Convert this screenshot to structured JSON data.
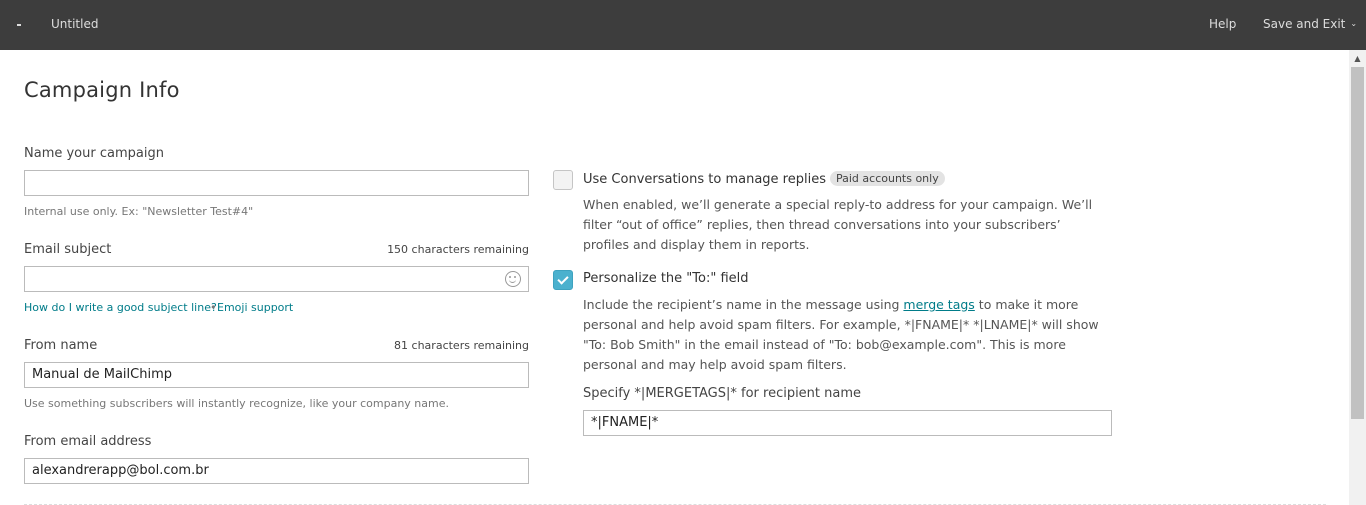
{
  "topbar": {
    "title": "Untitled",
    "help_label": "Help",
    "save_exit_label": "Save and Exit",
    "chevron": "⌄"
  },
  "page": {
    "title": "Campaign Info"
  },
  "campaign_name": {
    "label": "Name your campaign",
    "value": "",
    "help": "Internal use only. Ex: \"Newsletter Test#4\""
  },
  "email_subject": {
    "label": "Email subject",
    "counter": "150 characters remaining",
    "value": "",
    "link_subject": "How do I write a good subject line?",
    "separator": "•",
    "link_emoji": "Emoji support",
    "icon": "emoji-icon"
  },
  "from_name": {
    "label": "From name",
    "counter": "81 characters remaining",
    "value": "Manual de MailChimp",
    "help": "Use something subscribers will instantly recognize, like your company name."
  },
  "from_email": {
    "label": "From email address",
    "value": "alexandrerapp@bol.com.br"
  },
  "conversations": {
    "checked": false,
    "title": "Use Conversations to manage replies",
    "badge": "Paid accounts only",
    "description": "When enabled, we’ll generate a special reply-to address for your campaign. We’ll filter “out of office” replies, then thread conversations into your subscribers’ profiles and display them in reports."
  },
  "personalize": {
    "checked": true,
    "title": "Personalize the \"To:\" field",
    "desc_before": "Include the recipient’s name in the message using ",
    "desc_link": "merge tags",
    "desc_after": " to make it more personal and help avoid spam filters. For example, *|FNAME|* *|LNAME|* will show \"To: Bob Smith\" in the email instead of \"To: bob@example.com\". This is more personal and may help avoid spam filters.",
    "mergetags_label": "Specify *|MERGETAGS|* for recipient name",
    "mergetags_value": "*|FNAME|*"
  },
  "scrollbar": {
    "up_arrow": "▲"
  },
  "colors": {
    "topbar": "#3d3d3d",
    "link": "#007c89",
    "checkbox_checked": "#4bb1ce"
  }
}
